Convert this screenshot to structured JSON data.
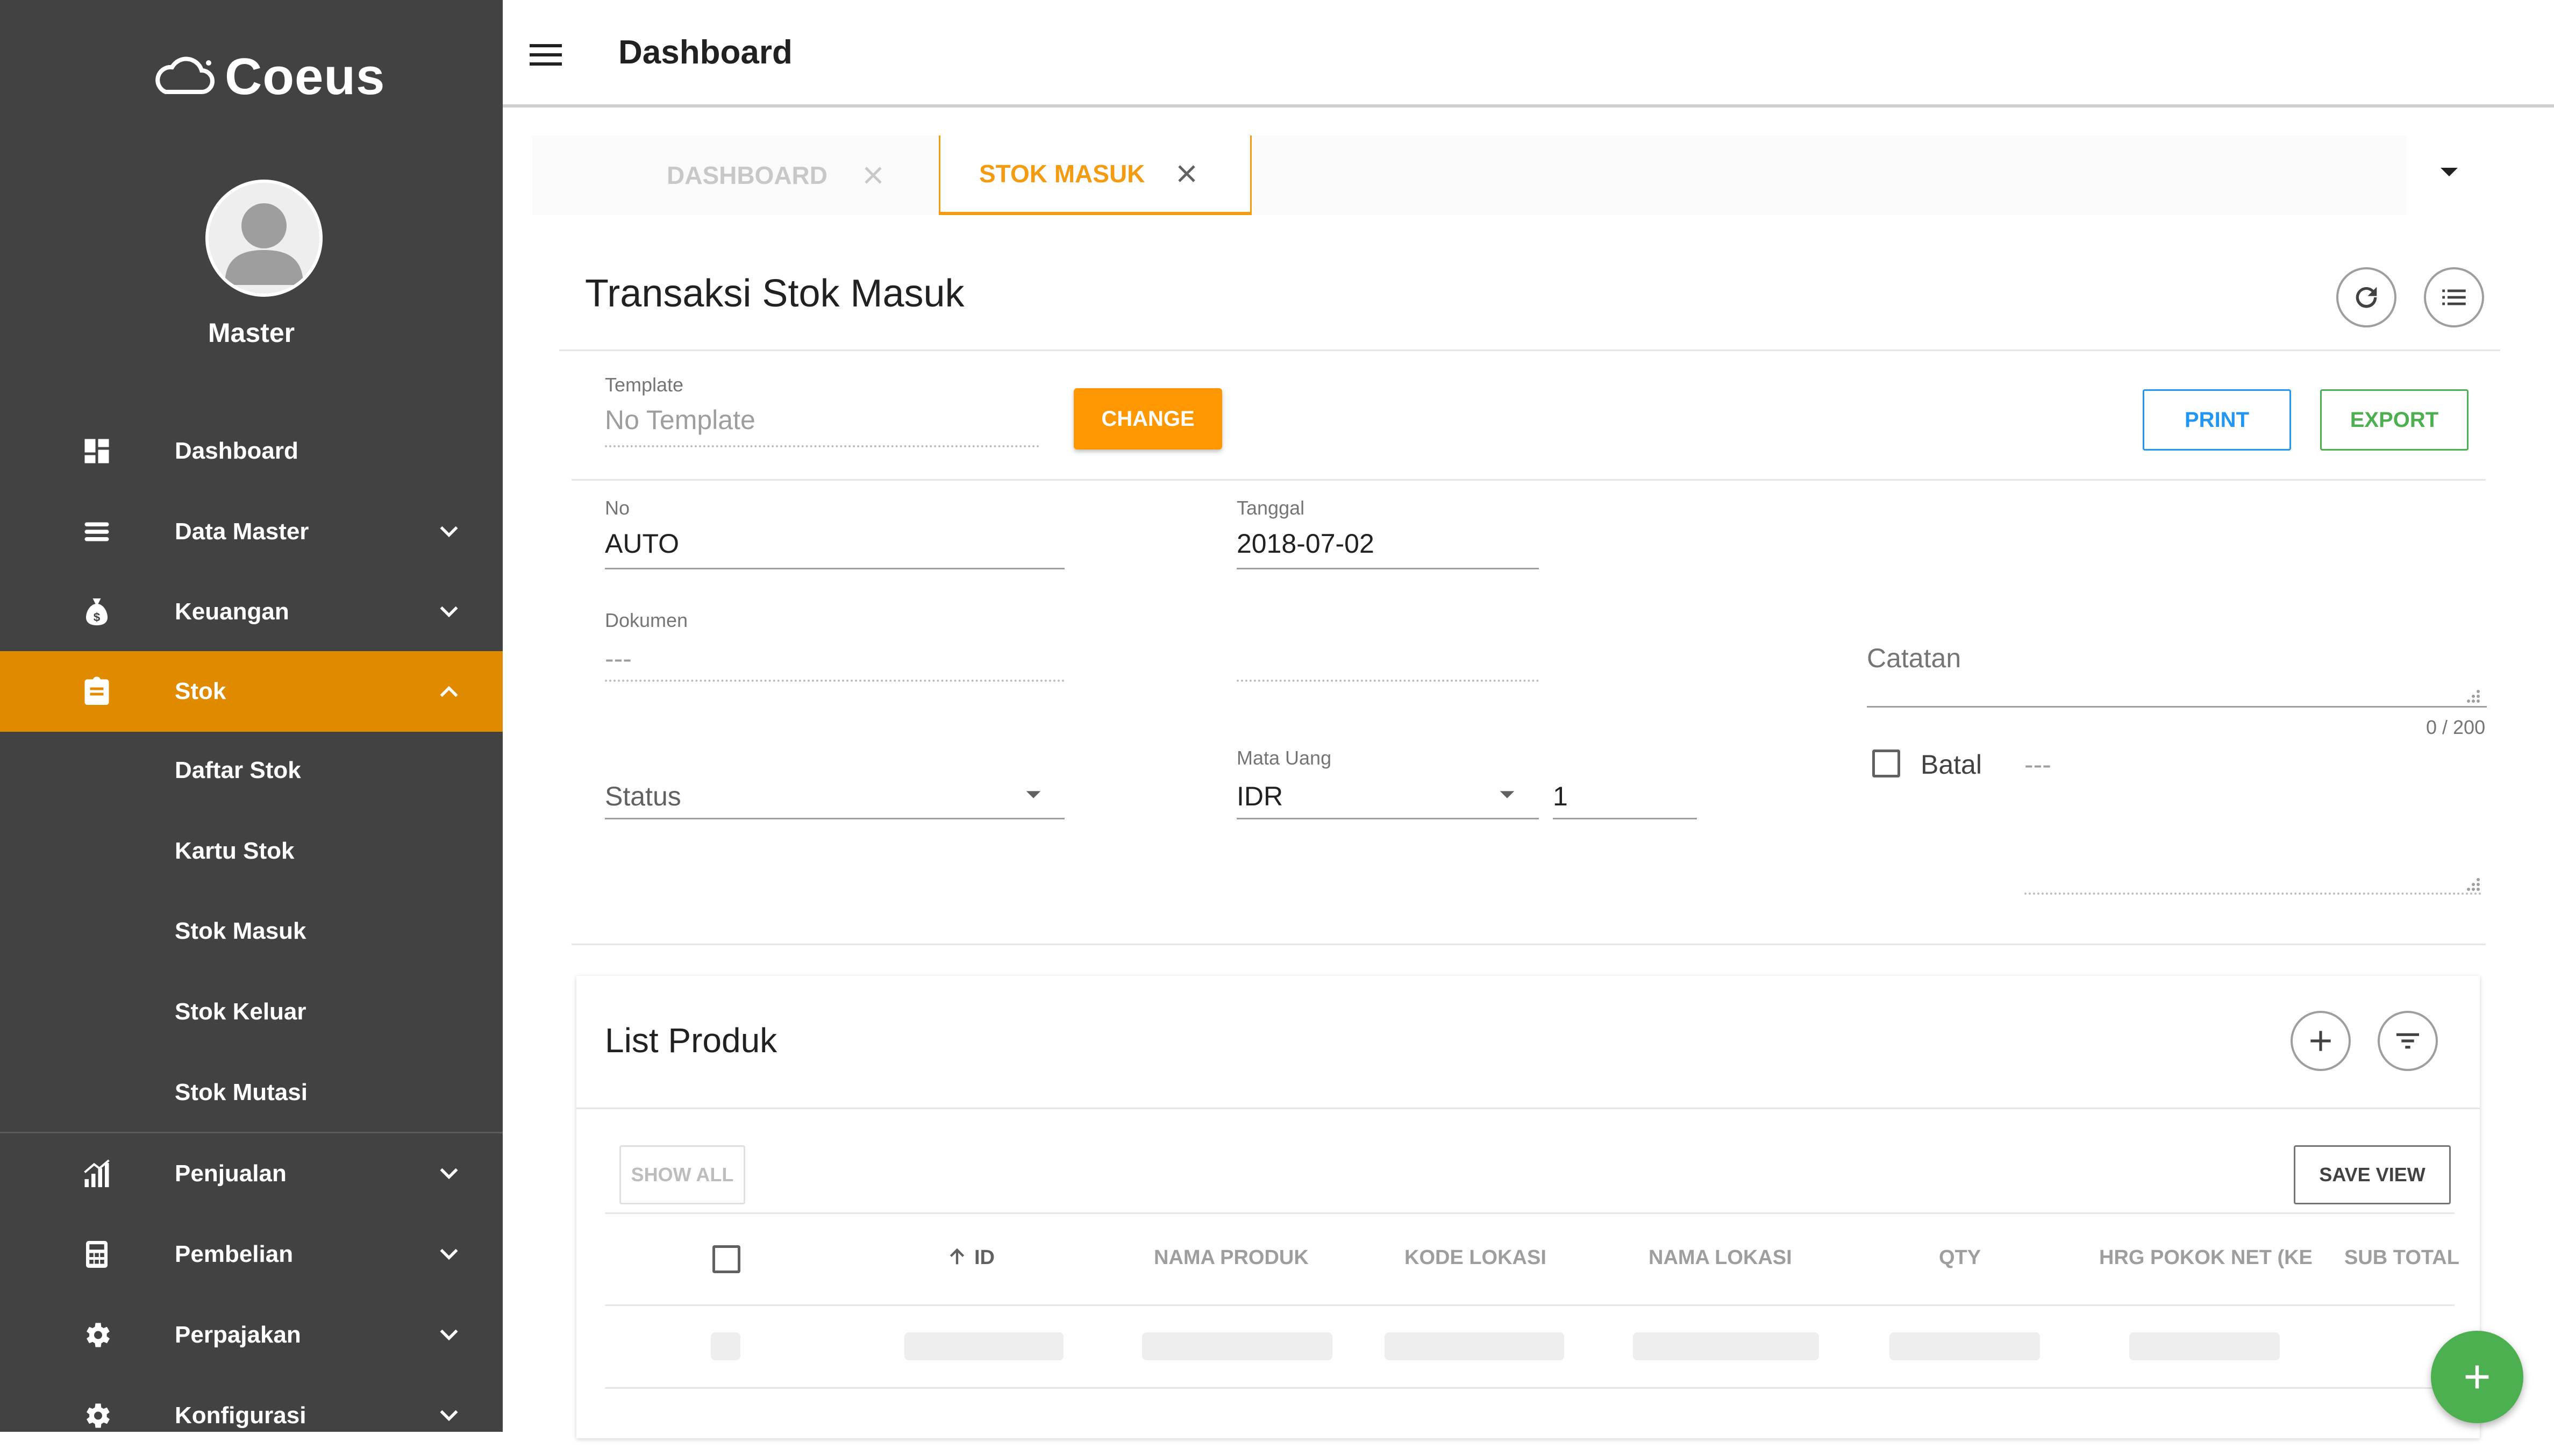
{
  "app": {
    "name": "Coeus"
  },
  "user": {
    "name": "Master"
  },
  "sidebar": {
    "items": [
      {
        "label": "Dashboard",
        "icon": "dashboard-icon"
      },
      {
        "label": "Data Master",
        "icon": "layers-icon"
      },
      {
        "label": "Keuangan",
        "icon": "money-bag-icon"
      },
      {
        "label": "Stok",
        "icon": "clipboard-icon",
        "active": true
      },
      {
        "label": "Penjualan",
        "icon": "bar-chart-icon"
      },
      {
        "label": "Pembelian",
        "icon": "calculator-icon"
      },
      {
        "label": "Perpajakan",
        "icon": "gear-icon"
      },
      {
        "label": "Konfigurasi",
        "icon": "gear-icon"
      }
    ],
    "stok_submenu": [
      "Daftar Stok",
      "Kartu Stok",
      "Stok Masuk",
      "Stok Keluar",
      "Stok Mutasi"
    ]
  },
  "header": {
    "title": "Dashboard"
  },
  "tabs": [
    {
      "label": "DASHBOARD",
      "active": false
    },
    {
      "label": "STOK MASUK",
      "active": true
    }
  ],
  "form": {
    "title": "Transaksi Stok Masuk",
    "template": {
      "label": "Template",
      "value": "No Template",
      "change_label": "CHANGE"
    },
    "print_label": "PRINT",
    "export_label": "EXPORT",
    "no": {
      "label": "No",
      "value": "AUTO"
    },
    "tanggal": {
      "label": "Tanggal",
      "value": "2018-07-02"
    },
    "dokumen": {
      "label": "Dokumen",
      "value": "---"
    },
    "catatan": {
      "placeholder": "Catatan",
      "counter": "0 / 200"
    },
    "status": {
      "placeholder": "Status"
    },
    "mata_uang": {
      "label": "Mata Uang",
      "value": "IDR",
      "rate": "1"
    },
    "batal": {
      "label": "Batal",
      "value": "---",
      "checked": false
    }
  },
  "list_produk": {
    "title": "List Produk",
    "show_all_label": "SHOW ALL",
    "save_view_label": "SAVE VIEW",
    "columns": [
      "ID",
      "NAMA PRODUK",
      "KODE LOKASI",
      "NAMA LOKASI",
      "QTY",
      "HRG POKOK NET (KE",
      "SUB TOTAL"
    ]
  },
  "colors": {
    "sidebar_bg": "#424242",
    "accent": "#ff9800",
    "active_nav": "#e08a00",
    "print": "#2196f3",
    "export": "#4caf50",
    "fab": "#4caf50"
  }
}
